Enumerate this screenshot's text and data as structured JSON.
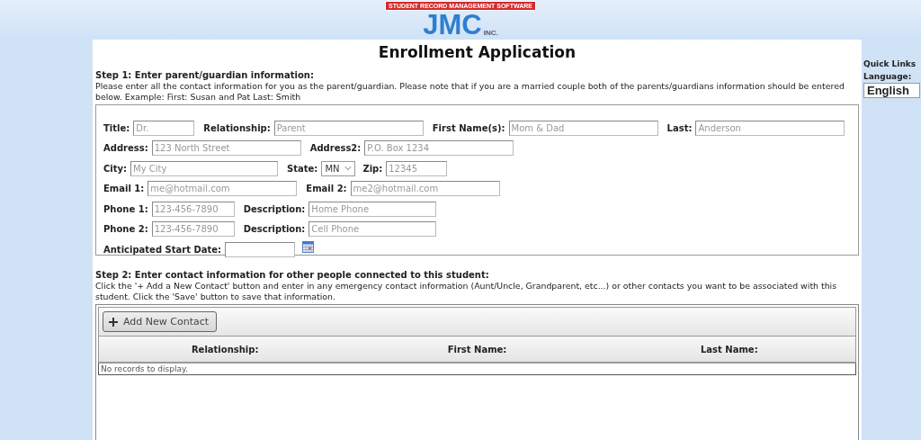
{
  "logo": {
    "wordmark": "JMC",
    "banner": "STUDENT RECORD MANAGEMENT SOFTWARE",
    "suffix": "INC."
  },
  "title": "Enrollment Application",
  "step1": {
    "heading": "Step 1: Enter parent/guardian information:",
    "description": "Please enter all the contact information for you as the parent/guardian. Please note that if you are a married couple both of the parents/guardians information should be entered below. Example: First: Susan and Pat Last: Smith",
    "rows": [
      [
        {
          "kind": "text",
          "label": "Title:",
          "placeholder": "Dr."
        },
        {
          "kind": "text",
          "label": "Relationship:",
          "placeholder": "Parent"
        },
        {
          "kind": "text",
          "label": "First Name(s):",
          "placeholder": "Mom & Dad"
        },
        {
          "kind": "text",
          "label": "Last:",
          "placeholder": "Anderson"
        }
      ],
      [
        {
          "kind": "text",
          "label": "Address:",
          "placeholder": "123 North Street"
        },
        {
          "kind": "text",
          "label": "Address2:",
          "placeholder": "P.O. Box 1234"
        }
      ],
      [
        {
          "kind": "text",
          "label": "City:",
          "placeholder": "My City"
        },
        {
          "kind": "select",
          "label": "State:",
          "value": "MN"
        },
        {
          "kind": "text",
          "label": "Zip:",
          "placeholder": "12345"
        }
      ],
      [
        {
          "kind": "text",
          "label": "Email 1:",
          "placeholder": "me@hotmail.com"
        },
        {
          "kind": "text",
          "label": "Email 2:",
          "placeholder": "me2@hotmail.com"
        }
      ],
      [
        {
          "kind": "text",
          "label": "Phone 1:",
          "placeholder": "123-456-7890"
        },
        {
          "kind": "text",
          "label": "Description:",
          "placeholder": "Home Phone"
        }
      ],
      [
        {
          "kind": "text",
          "label": "Phone 2:",
          "placeholder": "123-456-7890"
        },
        {
          "kind": "text",
          "label": "Description:",
          "placeholder": "Cell Phone"
        }
      ],
      [
        {
          "kind": "date",
          "label": "Anticipated Start Date:"
        }
      ]
    ]
  },
  "step2": {
    "heading": "Step 2: Enter contact information for other people connected to this student:",
    "description": "Click the '+ Add a New Contact' button and enter in any emergency contact information (Aunt/Uncle, Grandparent, etc...) or other contacts you want to be associated with this student. Click the 'Save' button to save that information.",
    "add_button": "Add New Contact",
    "columns": [
      "Relationship:",
      "First Name:",
      "Last Name:"
    ],
    "empty_message": "No records to display."
  },
  "sidebar": {
    "heading": "Quick Links",
    "language_label": "Language:",
    "language": "English"
  }
}
